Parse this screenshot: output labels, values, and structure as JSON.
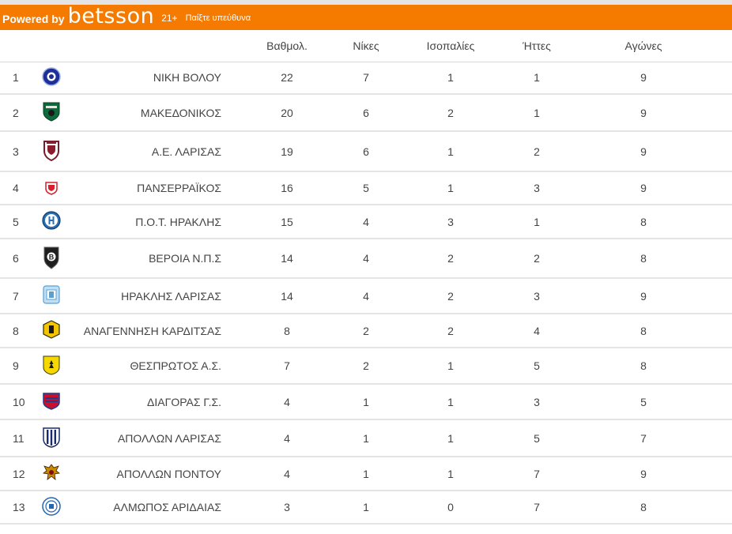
{
  "banner": {
    "powered_label": "Powered by",
    "brand": "betsson",
    "age_label": "21+",
    "responsible_label": "Παίξτε υπεύθυνα",
    "color": "#f57b00"
  },
  "table": {
    "headers": [
      "Βαθμολ.",
      "Νίκες",
      "Ισοπαλίες",
      "Ήττες",
      "Αγώνες"
    ],
    "rows": [
      {
        "pos": "1",
        "team": "ΝΙΚΗ ΒΟΛΟΥ",
        "points": "22",
        "wins": "7",
        "draws": "1",
        "losses": "1",
        "played": "9",
        "crest": "niki-volou-crest"
      },
      {
        "pos": "2",
        "team": "ΜΑΚΕΔΟΝΙΚΟΣ",
        "points": "20",
        "wins": "6",
        "draws": "2",
        "losses": "1",
        "played": "9",
        "crest": "makedonikos-crest"
      },
      {
        "pos": "3",
        "team": "Α.Ε. ΛΑΡΙΣΑΣ",
        "points": "19",
        "wins": "6",
        "draws": "1",
        "losses": "2",
        "played": "9",
        "crest": "ae-larisas-crest"
      },
      {
        "pos": "4",
        "team": "ΠΑΝΣΕΡΡΑΪΚΟΣ",
        "points": "16",
        "wins": "5",
        "draws": "1",
        "losses": "3",
        "played": "9",
        "crest": "panserraikos-crest"
      },
      {
        "pos": "5",
        "team": "Π.Ο.Τ. ΗΡΑΚΛΗΣ",
        "points": "15",
        "wins": "4",
        "draws": "3",
        "losses": "1",
        "played": "8",
        "crest": "iraklis-crest"
      },
      {
        "pos": "6",
        "team": "ΒΕΡΟΙΑ Ν.Π.Σ",
        "points": "14",
        "wins": "4",
        "draws": "2",
        "losses": "2",
        "played": "8",
        "crest": "veroia-crest"
      },
      {
        "pos": "7",
        "team": "ΗΡΑΚΛΗΣ ΛΑΡΙΣΑΣ",
        "points": "14",
        "wins": "4",
        "draws": "2",
        "losses": "3",
        "played": "9",
        "crest": "iraklis-larisas-crest"
      },
      {
        "pos": "8",
        "team": "ΑΝΑΓΕΝΝΗΣΗ ΚΑΡΔΙΤΣΑΣ",
        "points": "8",
        "wins": "2",
        "draws": "2",
        "losses": "4",
        "played": "8",
        "crest": "anagennisi-karditsas-crest"
      },
      {
        "pos": "9",
        "team": "ΘΕΣΠΡΩΤΟΣ Α.Σ.",
        "points": "7",
        "wins": "2",
        "draws": "1",
        "losses": "5",
        "played": "8",
        "crest": "thesprotos-crest"
      },
      {
        "pos": "10",
        "team": "ΔΙΑΓΟΡΑΣ Γ.Σ.",
        "points": "4",
        "wins": "1",
        "draws": "1",
        "losses": "3",
        "played": "5",
        "crest": "diagoras-crest"
      },
      {
        "pos": "11",
        "team": "ΑΠΟΛΛΩΝ ΛΑΡΙΣΑΣ",
        "points": "4",
        "wins": "1",
        "draws": "1",
        "losses": "5",
        "played": "7",
        "crest": "apollon-larisas-crest"
      },
      {
        "pos": "12",
        "team": "ΑΠΟΛΛΩΝ ΠΟΝΤΟΥ",
        "points": "4",
        "wins": "1",
        "draws": "1",
        "losses": "7",
        "played": "9",
        "crest": "apollon-pontou-crest"
      },
      {
        "pos": "13",
        "team": "ΑΛΜΩΠΟΣ ΑΡΙΔΑΙΑΣ",
        "points": "3",
        "wins": "1",
        "draws": "0",
        "losses": "7",
        "played": "8",
        "crest": "almopos-aridaias-crest"
      }
    ]
  }
}
